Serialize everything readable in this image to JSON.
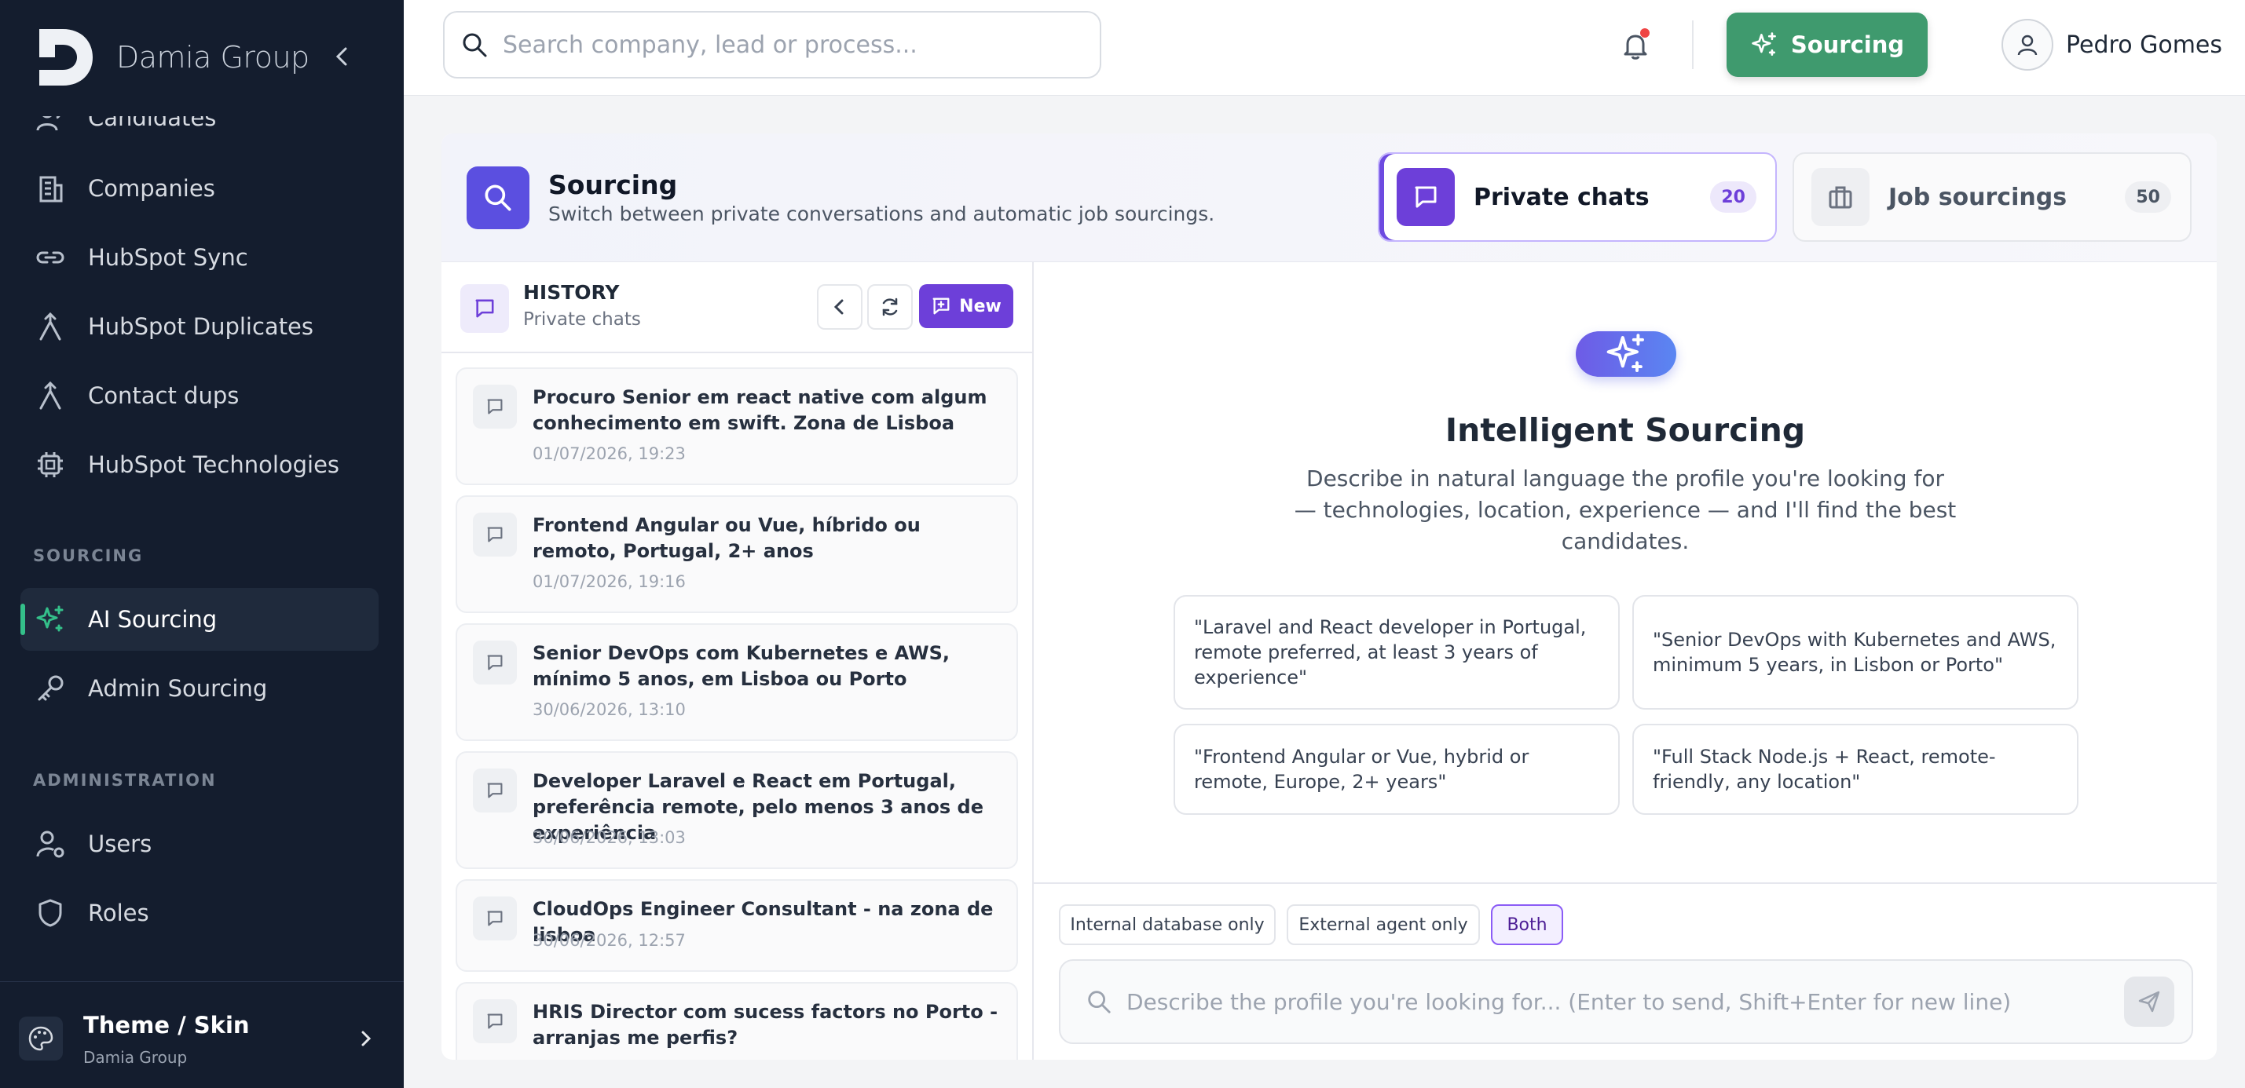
{
  "brand": {
    "name": "Damia Group"
  },
  "sidebar": {
    "items": [
      {
        "label": "Candidates",
        "icon": "candidates-icon"
      },
      {
        "label": "Companies",
        "icon": "building-icon"
      },
      {
        "label": "HubSpot Sync",
        "icon": "link-icon"
      },
      {
        "label": "HubSpot Duplicates",
        "icon": "merge-icon"
      },
      {
        "label": "Contact dups",
        "icon": "merge-icon"
      },
      {
        "label": "HubSpot Technologies",
        "icon": "chip-icon"
      }
    ],
    "sections": {
      "sourcing": "SOURCING",
      "administration": "ADMINISTRATION"
    },
    "sourcing_items": [
      {
        "label": "AI Sourcing",
        "icon": "sparkles-icon",
        "active": true
      },
      {
        "label": "Admin Sourcing",
        "icon": "key-icon"
      }
    ],
    "admin_items": [
      {
        "label": "Users",
        "icon": "user-gear-icon"
      },
      {
        "label": "Roles",
        "icon": "shield-icon"
      }
    ],
    "theme": {
      "title": "Theme / Skin",
      "subtitle": "Damia Group"
    }
  },
  "topbar": {
    "search_placeholder": "Search company, lead or process...",
    "sourcing_button": "Sourcing",
    "user_name": "Pedro Gomes"
  },
  "header": {
    "title": "Sourcing",
    "subtitle": "Switch between private conversations and automatic job sourcings.",
    "tabs": [
      {
        "label": "Private chats",
        "count": "20",
        "active": true
      },
      {
        "label": "Job sourcings",
        "count": "50",
        "active": false
      }
    ]
  },
  "history": {
    "title": "HISTORY",
    "subtitle": "Private chats",
    "new_label": "New",
    "items": [
      {
        "title": "Procuro Senior em react native com algum conhecimento em swift. Zona de Lisboa",
        "date": "01/07/2026, 19:23"
      },
      {
        "title": "Frontend Angular ou Vue, híbrido ou remoto, Portugal, 2+ anos",
        "date": "01/07/2026, 19:16"
      },
      {
        "title": "Senior DevOps com Kubernetes e AWS, mínimo 5 anos, em Lisboa ou Porto",
        "date": "30/06/2026, 13:10"
      },
      {
        "title": "Developer Laravel e React em Portugal, preferência remote, pelo menos 3 anos de experiência",
        "date": "30/06/2026, 13:03"
      },
      {
        "title": "CloudOps Engineer Consultant - na zona de lisboa",
        "date": "30/06/2026, 12:57"
      },
      {
        "title": "HRIS Director com sucess factors no Porto - arranjas me perfis?",
        "date": ""
      }
    ]
  },
  "main": {
    "title": "Intelligent Sourcing",
    "description": "Describe in natural language the profile you're looking for — technologies, location, experience — and I'll find the best candidates.",
    "suggestions": [
      "\"Laravel and React developer in Portugal, remote preferred, at least 3 years of experience\"",
      "\"Senior DevOps with Kubernetes and AWS, minimum 5 years, in Lisbon or Porto\"",
      "\"Frontend Angular or Vue, hybrid or remote, Europe, 2+ years\"",
      "\"Full Stack Node.js + React, remote-friendly, any location\""
    ],
    "modes": [
      {
        "label": "Internal database only",
        "selected": false
      },
      {
        "label": "External agent only",
        "selected": false
      },
      {
        "label": "Both",
        "selected": true
      }
    ],
    "composer_placeholder": "Describe the profile you're looking for... (Enter to send, Shift+Enter for new line)"
  },
  "colors": {
    "sidebar_bg": "#141d2e",
    "accent_green": "#3f9a6e",
    "accent_purple": "#6d3fd9",
    "indigo": "#5b4fe0"
  }
}
